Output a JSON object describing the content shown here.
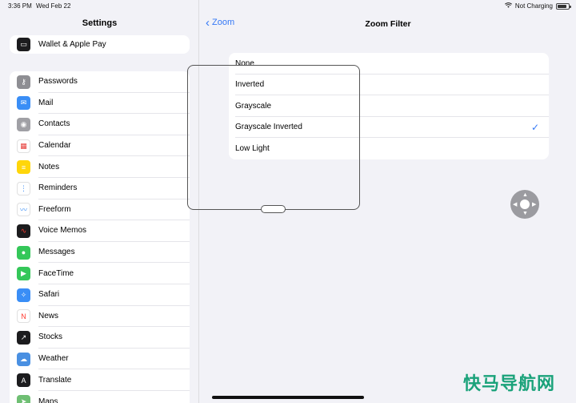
{
  "status": {
    "time": "3:36 PM",
    "date": "Wed Feb 22",
    "charging": "Not Charging",
    "battery_level": 0.85
  },
  "sidebar": {
    "title": "Settings",
    "top_group": [
      {
        "label": "Wallet & Apple Pay",
        "icon": "wallet-icon",
        "color": "#1c1c1e"
      }
    ],
    "items": [
      {
        "label": "Passwords",
        "icon": "key-icon",
        "color": "#8e8e93"
      },
      {
        "label": "Mail",
        "icon": "mail-icon",
        "color": "#3a8ef6"
      },
      {
        "label": "Contacts",
        "icon": "contacts-icon",
        "color": "#a0a0a5"
      },
      {
        "label": "Calendar",
        "icon": "calendar-icon",
        "color": "#ffffff"
      },
      {
        "label": "Notes",
        "icon": "notes-icon",
        "color": "#ffd60a"
      },
      {
        "label": "Reminders",
        "icon": "reminders-icon",
        "color": "#ffffff"
      },
      {
        "label": "Freeform",
        "icon": "freeform-icon",
        "color": "#ffffff"
      },
      {
        "label": "Voice Memos",
        "icon": "voice-memos-icon",
        "color": "#1c1c1e"
      },
      {
        "label": "Messages",
        "icon": "messages-icon",
        "color": "#34c759"
      },
      {
        "label": "FaceTime",
        "icon": "facetime-icon",
        "color": "#34c759"
      },
      {
        "label": "Safari",
        "icon": "safari-icon",
        "color": "#3a8ef6"
      },
      {
        "label": "News",
        "icon": "news-icon",
        "color": "#ffffff"
      },
      {
        "label": "Stocks",
        "icon": "stocks-icon",
        "color": "#1c1c1e"
      },
      {
        "label": "Weather",
        "icon": "weather-icon",
        "color": "#4a90e2"
      },
      {
        "label": "Translate",
        "icon": "translate-icon",
        "color": "#1c1c1e"
      },
      {
        "label": "Maps",
        "icon": "maps-icon",
        "color": "#6fbf73"
      }
    ]
  },
  "detail": {
    "back_label": "Zoom",
    "title": "Zoom Filter",
    "options": [
      {
        "label": "None",
        "checked": false
      },
      {
        "label": "Inverted",
        "checked": false
      },
      {
        "label": "Grayscale",
        "checked": false
      },
      {
        "label": "Grayscale Inverted",
        "checked": true
      },
      {
        "label": "Low Light",
        "checked": false
      }
    ],
    "check_glyph": "✓"
  },
  "accent_color": "#3478f6",
  "watermark": "快马导航网"
}
